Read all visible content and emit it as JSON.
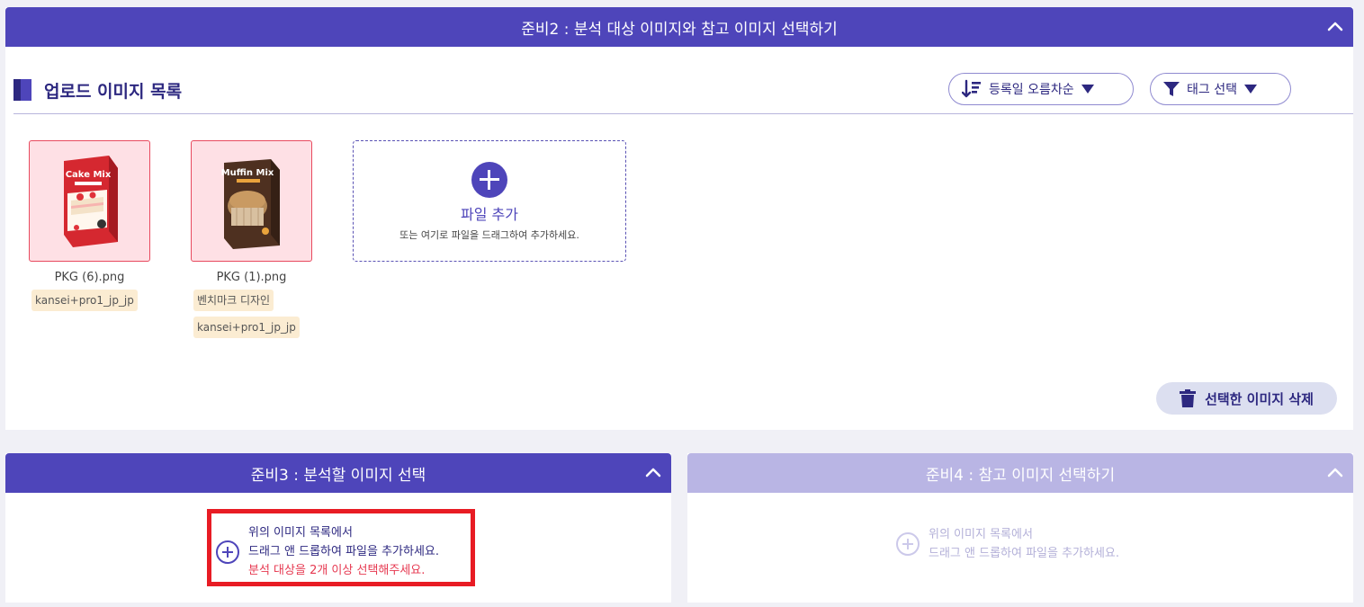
{
  "panel2": {
    "title": "준비2 : 분석 대상 이미지와 참고 이미지 선택하기",
    "section_title": "업로드 이미지 목록",
    "sort_label": "등록일 오름차순",
    "tag_label": "태그 선택",
    "images": [
      {
        "filename": "PKG (6).png",
        "product": "Cake Mix",
        "tags": [
          "kansei+pro1_jp_jp"
        ]
      },
      {
        "filename": "PKG (1).png",
        "product": "Muffin Mix",
        "tags": [
          "벤치마크 디자인",
          "kansei+pro1_jp_jp"
        ]
      }
    ],
    "dropzone": {
      "title": "파일 추가",
      "subtitle": "또는 여기로 파일을 드래그하여 추가하세요."
    },
    "delete_label": "선택한 이미지 삭제"
  },
  "panel3": {
    "title": "준비3 : 분석할 이미지 선택",
    "hint_line1": "위의 이미지 목록에서",
    "hint_line2": "드래그 앤 드롭하여 파일을 추가하세요.",
    "warning": "분석 대상을 2개 이상 선택해주세요."
  },
  "panel4": {
    "title": "준비4 : 참고 이미지 선택하기",
    "hint_line1": "위의 이미지 목록에서",
    "hint_line2": "드래그 앤 드롭하여 파일을 추가하세요."
  },
  "colors": {
    "primary": "#4e45ba",
    "primary_dark": "#2d2880",
    "disabled": "#b9b5e4",
    "warning": "#e63850",
    "highlight": "#e81c24",
    "thumb_bg": "#fee0e5",
    "tag_bg": "#fbecd2"
  }
}
